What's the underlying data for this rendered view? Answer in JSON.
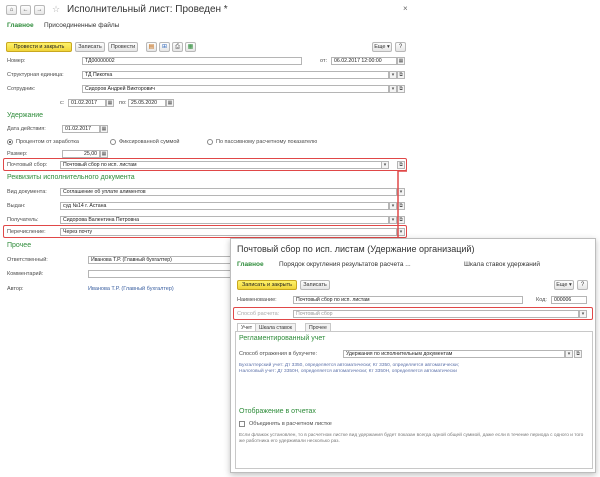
{
  "main": {
    "title": "Исполнительный лист: Проведен *",
    "tabs": [
      "Главное",
      "Присоединенные файлы"
    ],
    "toolbar": {
      "post_close": "Провести и закрыть",
      "save": "Записать",
      "post": "Провести",
      "more": "Еще"
    },
    "fields": {
      "number_label": "Номер:",
      "number": "ТД00000002",
      "from_label": "от:",
      "date": "06.02.2017 12:00:00",
      "dept_label": "Структурная единица:",
      "dept": "ТД Пикотка",
      "emp_label": "Сотрудник:",
      "emp": "Сидоров Андрей Викторович",
      "from2_label": "с:",
      "date_from": "01.02.2017",
      "to_label": "по:",
      "date_to": "25.05.2020"
    },
    "hold": {
      "title": "Удержание",
      "date_label": "Дата действия:",
      "date": "01.02.2017",
      "opt1": "Процентом от заработка",
      "opt2": "Фиксированной суммой",
      "opt3": "По пассивному расчетному показателю",
      "size_label": "Размер:",
      "size": "25,00",
      "fee_label": "Почтовый сбор:",
      "fee": "Почтовый сбор по исп. листам"
    },
    "req": {
      "title": "Реквизиты исполнительного документа",
      "doctype_label": "Вид документа:",
      "doctype": "Соглашение об уплате алиментов",
      "issued_label": "Выдан:",
      "issued": "суд №14 г. Астана",
      "recipient_label": "Получатель:",
      "recipient": "Сидорова Валентина Петровна",
      "transfer_label": "Перечисление:",
      "transfer": "Через почту"
    },
    "other": {
      "title": "Прочее",
      "resp_label": "Ответственный:",
      "resp": "Иванова Т.Р. (Главный бухгалтер)",
      "comment_label": "Комментарий:",
      "author_label": "Автор:",
      "author": "Иванова Т.Р. (Главный бухгалтер)"
    }
  },
  "popup": {
    "title": "Почтовый сбор по исп. листам (Удержание организаций)",
    "tabs": [
      "Главное",
      "Порядок округления результатов расчета ...",
      "Шкала ставок удержаний"
    ],
    "toolbar": {
      "save_close": "Записать и закрыть",
      "save": "Записать",
      "more": "Еще"
    },
    "name_label": "Наименование:",
    "name": "Почтовый сбор по исп. листам",
    "code_label": "Код:",
    "code": "000006",
    "method_label": "Способ расчета:",
    "method": "Почтовый сбор",
    "subtabs": [
      "Учет",
      "Шкала ставок",
      "Прочее"
    ],
    "reg_title": "Регламентированный учет",
    "reflect_label": "Способ отражения в бухучете:",
    "reflect": "Удержания по исполнительным документам",
    "acc1": "Бухгалтерский учет: Дт 3350, определяется автоматически; Кт 3350, определяется автоматически;",
    "acc2": "Налоговый учет: Дт 3350Н, определяется автоматически; Кт 3350Н, определяется автоматически",
    "rep_title": "Отображение в отчетах",
    "combine_label": "Объединять в расчетном листке",
    "note": "Если флажок установлен, то в расчетном листке вид удержания будет показан всегда одной общей суммой, даже если в течение периода с одного и того же работника его удерживали несколько раз."
  }
}
